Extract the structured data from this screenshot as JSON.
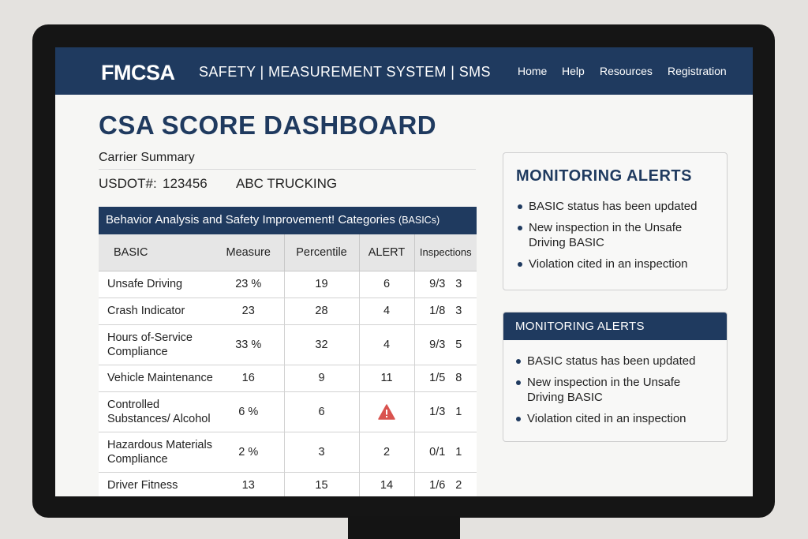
{
  "header": {
    "logo": "FMCSA",
    "system_title": "SAFETY | MEASUREMENT SYSTEM | SMS",
    "nav": [
      "Home",
      "Help",
      "Resources",
      "Registration"
    ]
  },
  "page_title": "CSA SCORE DASHBOARD",
  "carrier_summary": {
    "label": "Carrier Summary",
    "usdot_label": "USDOT#:",
    "usdot_number": "123456",
    "carrier_name": "ABC TRUCKING"
  },
  "basics_table": {
    "title": "Behavior Analysis and Safety Improvement! Categories",
    "title_suffix": "(BASICs)",
    "columns": [
      "BASIC",
      "Measure",
      "Percentile",
      "ALERT",
      "Inspections"
    ],
    "rows": [
      {
        "basic": "Unsafe Driving",
        "measure": "23 %",
        "percentile": "19",
        "alert": "6",
        "insp_a": "9/3",
        "insp_b": "3"
      },
      {
        "basic": "Crash Indicator",
        "measure": "23",
        "percentile": "28",
        "alert": "4",
        "insp_a": "1/8",
        "insp_b": "3"
      },
      {
        "basic": "Hours of-Service Compliance",
        "measure": "33 %",
        "percentile": "32",
        "alert": "4",
        "insp_a": "9/3",
        "insp_b": "5"
      },
      {
        "basic": "Vehicle Maintenance",
        "measure": "16",
        "percentile": "9",
        "alert": "11",
        "insp_a": "1/5",
        "insp_b": "8"
      },
      {
        "basic": "Controlled Substances/ Alcohol",
        "measure": "6 %",
        "percentile": "6",
        "alert": "warning-icon",
        "insp_a": "1/3",
        "insp_b": "1"
      },
      {
        "basic": "Hazardous Materials Compliance",
        "measure": "2 %",
        "percentile": "3",
        "alert": "2",
        "insp_a": "0/1",
        "insp_b": "1"
      },
      {
        "basic": "Driver Fitness",
        "measure": "13",
        "percentile": "15",
        "alert": "14",
        "insp_a": "1/6",
        "insp_b": "2"
      }
    ]
  },
  "monitoring_alerts_1": {
    "title": "MONITORING ALERTS",
    "items": [
      "BASIC status has been updated",
      "New inspection in the Unsafe Driving BASIC",
      "Violation cited in an inspection"
    ]
  },
  "monitoring_alerts_2": {
    "title": "MONITORING ALERTS",
    "items": [
      "BASIC status has been updated",
      "New inspection in the Unsafe Driving BASIC",
      "Violation cited in an inspection"
    ]
  },
  "colors": {
    "navy": "#1f3a5f",
    "warning": "#d9534f"
  }
}
